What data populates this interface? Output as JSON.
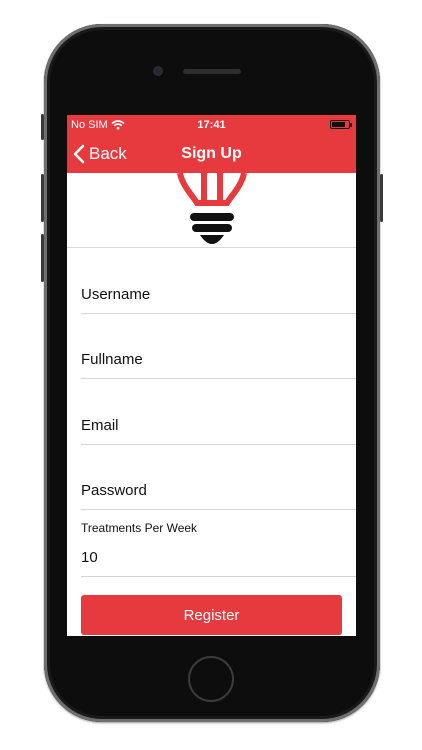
{
  "status_bar": {
    "carrier": "No SIM",
    "time": "17:41"
  },
  "nav": {
    "back_label": "Back",
    "title": "Sign Up"
  },
  "form": {
    "username_placeholder": "Username",
    "fullname_placeholder": "Fullname",
    "email_placeholder": "Email",
    "password_placeholder": "Password",
    "treatments_label": "Treatments Per Week",
    "treatments_value": "10"
  },
  "register_label": "Register",
  "colors": {
    "accent": "#e63a3f",
    "text": "#111111",
    "divider": "#d4d4d4"
  },
  "icons": [
    "wifi-icon",
    "battery-icon",
    "chevron-left-icon",
    "lightbulb-logo"
  ]
}
